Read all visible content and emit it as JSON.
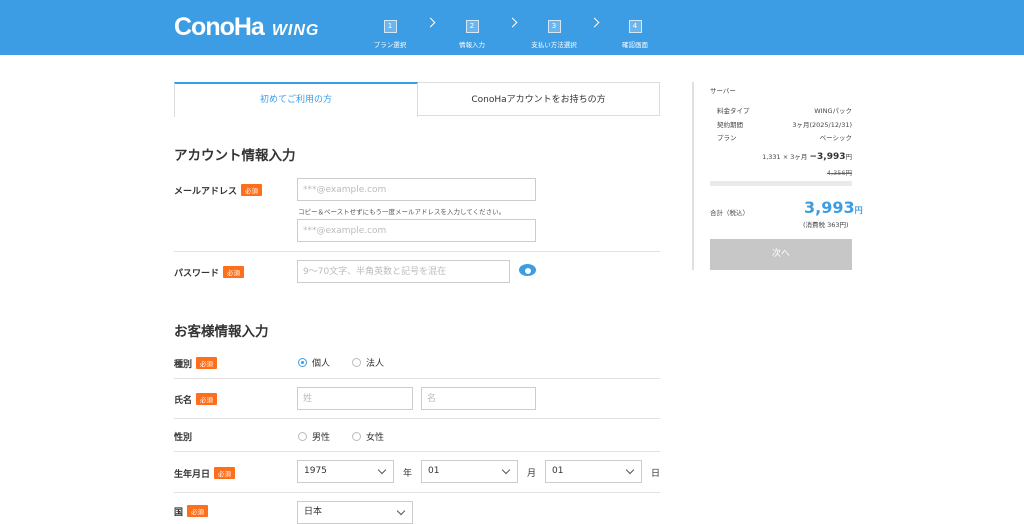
{
  "header": {
    "logo": "ConoHa",
    "logo_sub": "WING",
    "steps": [
      {
        "num": "1",
        "label": "プラン選択"
      },
      {
        "num": "2",
        "label": "情報入力"
      },
      {
        "num": "3",
        "label": "支払い方法選択"
      },
      {
        "num": "4",
        "label": "確認画面"
      }
    ]
  },
  "tabs": {
    "first": "初めてご利用の方",
    "second": "ConoHaアカウントをお持ちの方"
  },
  "account": {
    "title": "アカウント情報入力",
    "required": "必須",
    "email_label": "メールアドレス",
    "email_placeholder": "***@example.com",
    "email_hint": "コピー＆ペーストせずにもう一度メールアドレスを入力してください。",
    "email_confirm_placeholder": "***@example.com",
    "password_label": "パスワード",
    "password_placeholder": "9～70文字、半角英数と記号を混在"
  },
  "customer": {
    "title": "お客様情報入力",
    "type_label": "種別",
    "type_options": [
      "個人",
      "法人"
    ],
    "name_label": "氏名",
    "last_name_placeholder": "姓",
    "first_name_placeholder": "名",
    "gender_label": "性別",
    "gender_options": [
      "男性",
      "女性"
    ],
    "birth_label": "生年月日",
    "birth_year": "1975",
    "birth_month": "01",
    "birth_day": "01",
    "year_unit": "年",
    "month_unit": "月",
    "day_unit": "日",
    "country_label": "国",
    "country_value": "日本"
  },
  "summary": {
    "heading": "サーバー",
    "rows": [
      {
        "key": "料金タイプ",
        "value": "WINGパック"
      },
      {
        "key": "契約期間",
        "value": "3ヶ月(2025/12/31)"
      },
      {
        "key": "プラン",
        "value": "ベーシック"
      }
    ],
    "calc": "1,331 × 3ヶ月",
    "price": "−3,993",
    "price_unit": "円",
    "original_price": "4,356円",
    "total_label": "合計（税込）",
    "total_value": "3,993",
    "total_unit": "円",
    "tax_note": "(消費税 363円)",
    "next_button": "次へ"
  },
  "colors": {
    "accent": "#3c9ce4",
    "required_badge": "#ff6f1b",
    "disabled_button": "#c7c7c7"
  }
}
